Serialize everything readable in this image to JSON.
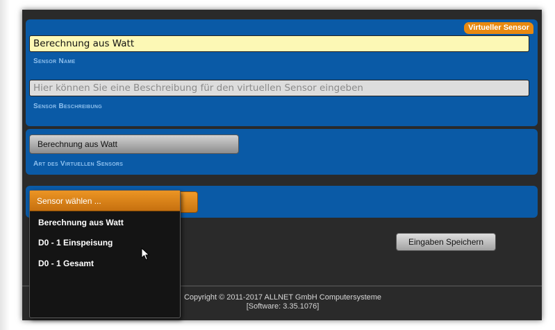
{
  "badge": "Virtueller Sensor",
  "sensor_name": {
    "value": "Berechnung aus Watt",
    "label": "Sensor Name"
  },
  "sensor_description": {
    "value": "",
    "placeholder": "Hier können Sie eine Beschreibung für den virtuellen Sensor eingeben",
    "label": "Sensor Beschreibung"
  },
  "sensor_type": {
    "value": "Berechnung aus Watt",
    "label": "Art des Virtuellen Sensors"
  },
  "sensor_select": {
    "header": "Sensor wählen ...",
    "options": [
      "Berechnung aus Watt",
      "D0 - 1 Einspeisung",
      "D0 - 1 Gesamt"
    ]
  },
  "save_button": "Eingaben Speichern",
  "footer": {
    "copyright": "Copyright © 2011-2017 ALLNET GmbH Computersysteme",
    "software": "[Software: 3.35.1076]"
  },
  "colors": {
    "panel_blue": "#0a5aa6",
    "accent_orange": "#e8890f",
    "label_blue": "#8ec0ee",
    "name_field_yellow": "#fcf8b5"
  }
}
